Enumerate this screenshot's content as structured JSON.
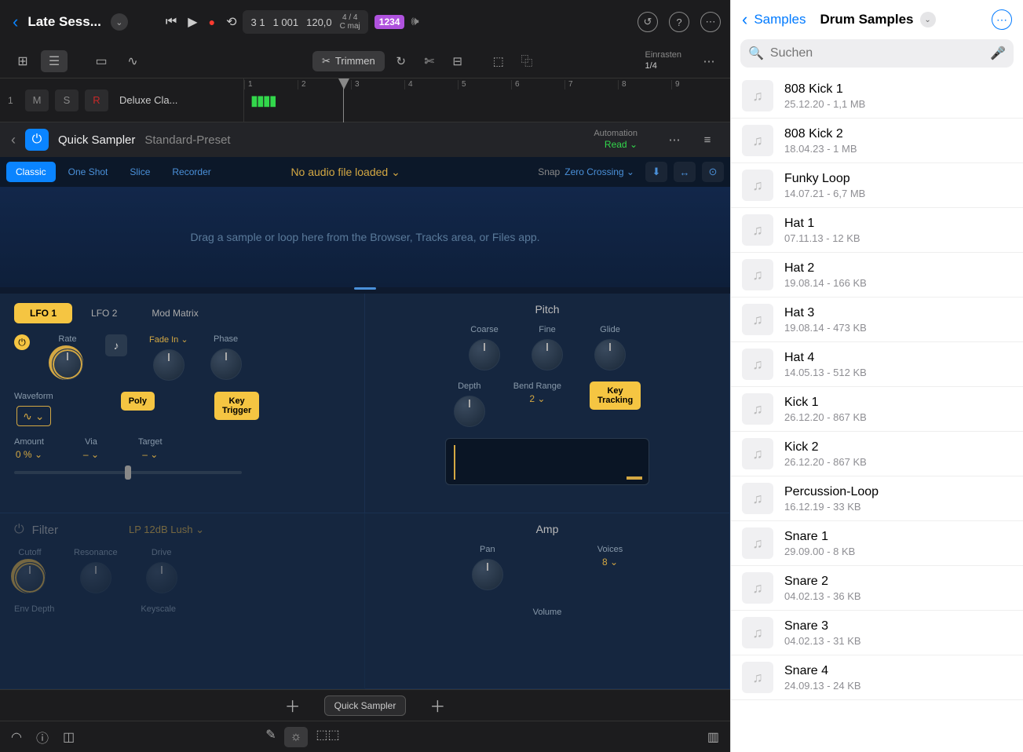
{
  "project": {
    "title": "Late Sess..."
  },
  "transport": {
    "bar": "3 1",
    "beat": "1 001",
    "tempo": "120,0",
    "sig": "4 / 4",
    "key": "C maj",
    "beat_display": "1234"
  },
  "toolbar": {
    "trim": "Trimmen",
    "snap_label": "Einrasten",
    "snap_value": "1/4"
  },
  "track": {
    "num": "1",
    "m": "M",
    "s": "S",
    "r": "R",
    "name": "Deluxe Cla...",
    "ruler": [
      "1",
      "2",
      "3",
      "4",
      "5",
      "6",
      "7",
      "8",
      "9"
    ]
  },
  "plugin": {
    "name": "Quick Sampler",
    "preset": "Standard-Preset",
    "auto_label": "Automation",
    "auto_value": "Read"
  },
  "sampler": {
    "tabs": [
      "Classic",
      "One Shot",
      "Slice",
      "Recorder"
    ],
    "no_audio": "No audio file loaded",
    "snap_label": "Snap",
    "snap_value": "Zero Crossing",
    "drop_hint": "Drag a sample or loop here from the Browser, Tracks area, or Files app.",
    "lfo_tabs": [
      "LFO 1",
      "LFO 2",
      "Mod Matrix"
    ],
    "rate": "Rate",
    "fade_in": "Fade In",
    "phase": "Phase",
    "waveform": "Waveform",
    "poly": "Poly",
    "key_trigger_l1": "Key",
    "key_trigger_l2": "Trigger",
    "amount": "Amount",
    "amount_val": "0 %",
    "via": "Via",
    "via_val": "–",
    "target": "Target",
    "target_val": "–",
    "pitch": "Pitch",
    "coarse": "Coarse",
    "fine": "Fine",
    "glide": "Glide",
    "depth": "Depth",
    "bend_range": "Bend Range",
    "bend_val": "2",
    "key_track_l1": "Key",
    "key_track_l2": "Tracking",
    "filter": "Filter",
    "filter_type": "LP 12dB Lush",
    "cutoff": "Cutoff",
    "resonance": "Resonance",
    "drive": "Drive",
    "env_depth": "Env Depth",
    "keyscale": "Keyscale",
    "amp": "Amp",
    "pan": "Pan",
    "voices": "Voices",
    "voices_val": "8",
    "volume": "Volume"
  },
  "strip": {
    "plugin": "Quick Sampler"
  },
  "side": {
    "back": "Samples",
    "title": "Drum Samples",
    "search_ph": "Suchen",
    "items": [
      {
        "name": "808 Kick 1",
        "meta": "25.12.20 - 1,1 MB"
      },
      {
        "name": "808 Kick 2",
        "meta": "18.04.23 - 1 MB"
      },
      {
        "name": "Funky Loop",
        "meta": "14.07.21 - 6,7 MB"
      },
      {
        "name": "Hat 1",
        "meta": "07.11.13 - 12 KB"
      },
      {
        "name": "Hat 2",
        "meta": "19.08.14 - 166 KB"
      },
      {
        "name": "Hat 3",
        "meta": "19.08.14 - 473 KB"
      },
      {
        "name": "Hat 4",
        "meta": "14.05.13 - 512 KB"
      },
      {
        "name": "Kick 1",
        "meta": "26.12.20 - 867 KB"
      },
      {
        "name": "Kick 2",
        "meta": "26.12.20 - 867 KB"
      },
      {
        "name": "Percussion-Loop",
        "meta": "16.12.19 - 33 KB"
      },
      {
        "name": "Snare 1",
        "meta": "29.09.00 - 8 KB"
      },
      {
        "name": "Snare 2",
        "meta": "04.02.13 - 36 KB"
      },
      {
        "name": "Snare 3",
        "meta": "04.02.13 - 31 KB"
      },
      {
        "name": "Snare 4",
        "meta": "24.09.13 - 24 KB"
      }
    ]
  }
}
